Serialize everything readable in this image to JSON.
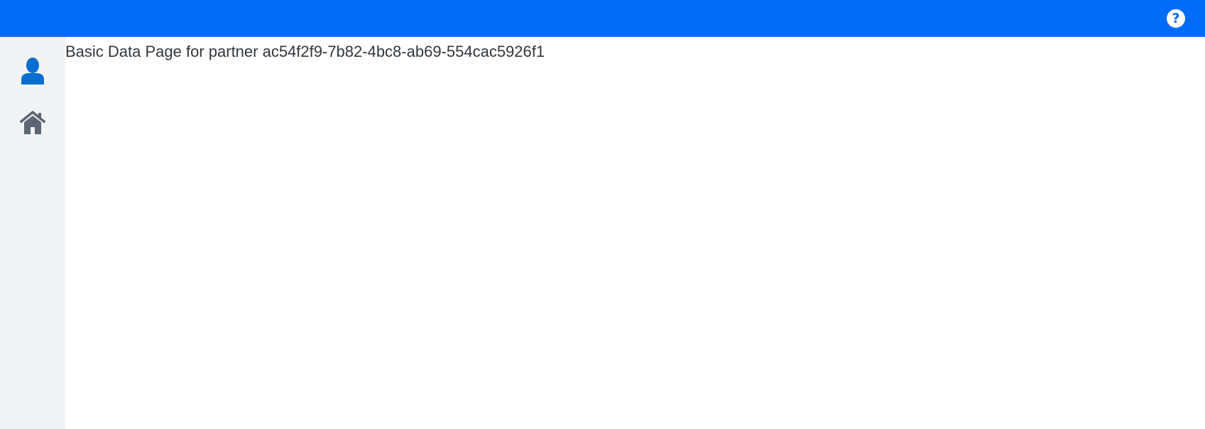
{
  "header": {
    "help_icon": "help-question-icon",
    "help_glyph": "?",
    "accent_color": "#006bf6"
  },
  "sidebar": {
    "items": [
      {
        "icon": "person-icon",
        "active": true,
        "color": "#0a6ed1"
      },
      {
        "icon": "home-icon",
        "active": false,
        "color": "#5b6573"
      }
    ]
  },
  "main": {
    "title": "Basic Data Page for partner ac54f2f9-7b82-4bc8-ab69-554cac5926f1"
  }
}
